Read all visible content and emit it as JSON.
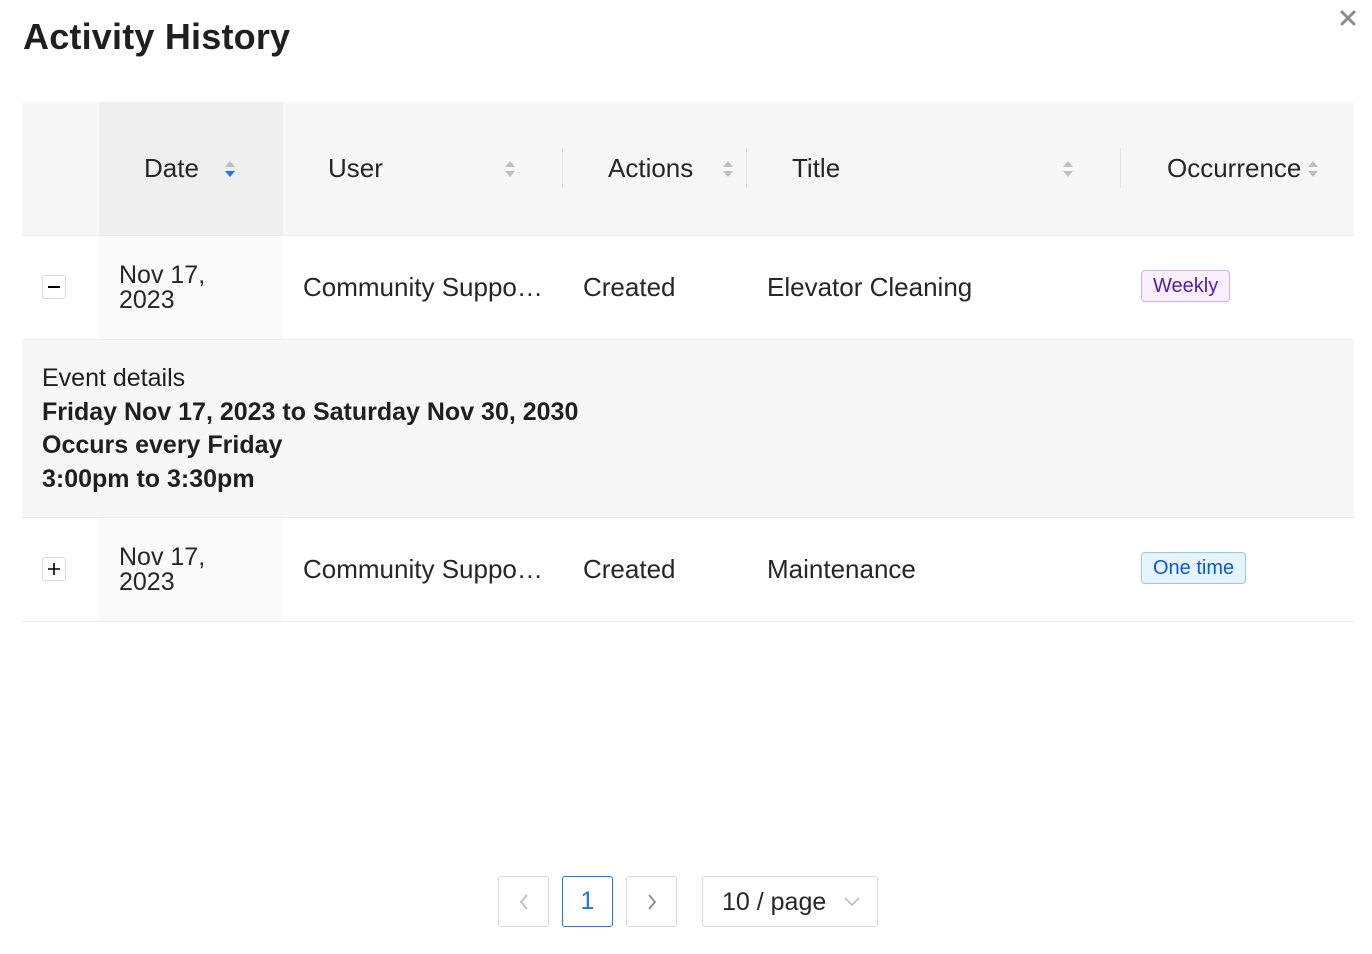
{
  "modal": {
    "title": "Activity History"
  },
  "table": {
    "columns": {
      "date": "Date",
      "user": "User",
      "actions": "Actions",
      "title": "Title",
      "occurrence": "Occurrence"
    },
    "rows": [
      {
        "date_line1": "Nov 17,",
        "date_line2": "2023",
        "user": "Community Suppo…",
        "action": "Created",
        "title": "Elevator Cleaning",
        "occurrence": "Weekly",
        "expanded": true,
        "expander_symbol": "minus"
      },
      {
        "date_line1": "Nov 17,",
        "date_line2": "2023",
        "user": "Community Suppo…",
        "action": "Created",
        "title": "Maintenance",
        "occurrence": "One time",
        "expanded": false,
        "expander_symbol": "plus"
      }
    ],
    "event_details": {
      "heading": "Event details",
      "range": "Friday Nov 17, 2023 to Saturday Nov 30, 2030",
      "recurrence": "Occurs every Friday",
      "time": "3:00pm to 3:30pm"
    },
    "sort": {
      "active_column": "date",
      "direction": "descending"
    }
  },
  "pagination": {
    "current_page": "1",
    "page_size": "10 / page",
    "prev_icon": "chevron-left-icon",
    "next_icon": "chevron-right-icon"
  },
  "colors": {
    "accent": "#1677ff",
    "weekly_tag_text": "#531dab",
    "weekly_tag_bg": "#f9f0ff",
    "onetime_tag_text": "#0958d9",
    "onetime_tag_bg": "#e6f4ff",
    "header_bg": "#f7f7f7"
  }
}
